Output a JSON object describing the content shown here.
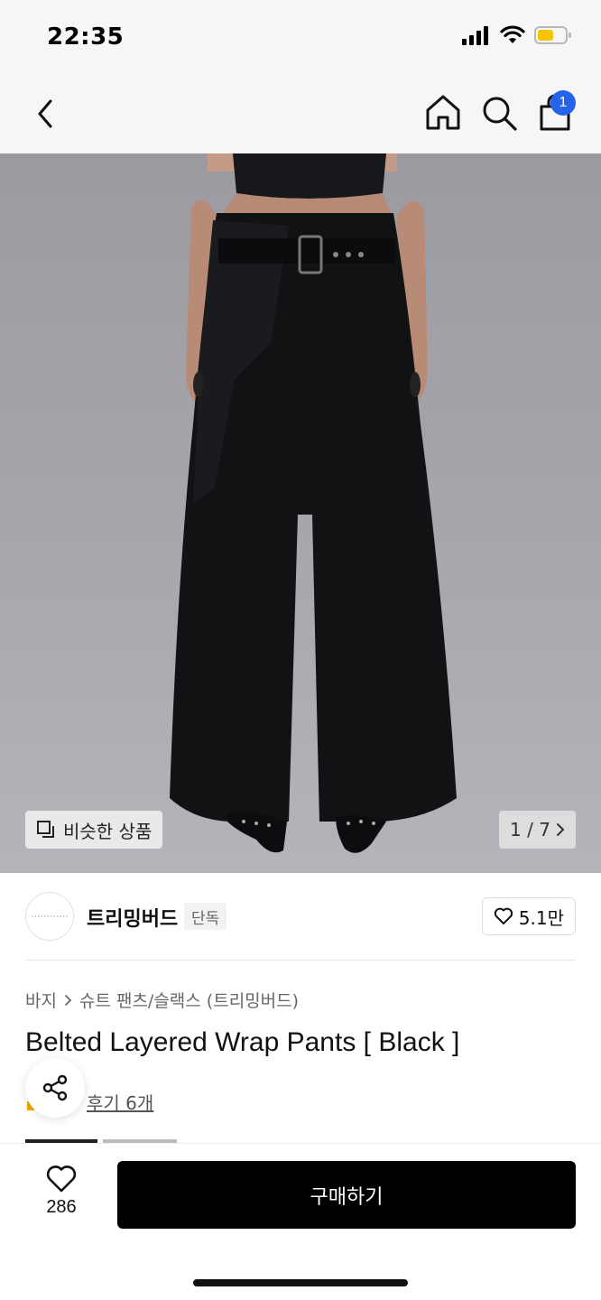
{
  "status_bar": {
    "time": "22:35"
  },
  "nav": {
    "cart_count": "1"
  },
  "gallery": {
    "similar_label": "비슷한 상품",
    "counter": "1 / 7"
  },
  "brand": {
    "name": "트리밍버드",
    "tag": "단독",
    "like_count": "5.1만"
  },
  "breadcrumb": {
    "level1": "바지",
    "level2": "슈트 팬츠/슬랙스 (트리밍버드)"
  },
  "product": {
    "title": "Belted Layered Wrap Pants [ Black ]",
    "review_link": "후기 6개"
  },
  "bottom_bar": {
    "like_count": "286",
    "buy_label": "구매하기"
  },
  "colors": {
    "badge": "#2563eb",
    "buy_button": "#000000"
  }
}
